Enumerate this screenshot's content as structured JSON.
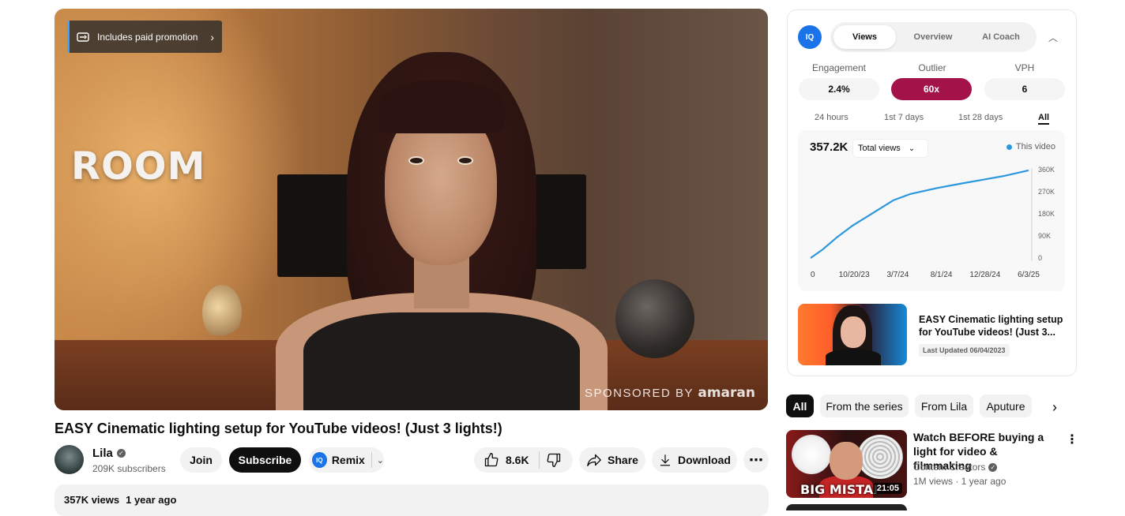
{
  "player": {
    "paid_promotion": "Includes paid promotion",
    "overlay_word": "ROOM",
    "sponsored_prefix": "SPONSORED BY",
    "sponsor_brand": "amaran"
  },
  "video": {
    "title": "EASY Cinematic lighting setup for YouTube videos! (Just 3 lights!)",
    "channel_name": "Lila",
    "subscribers": "209K subscribers",
    "join_label": "Join",
    "subscribe_label": "Subscribe",
    "remix_label": "Remix",
    "likes": "8.6K",
    "share_label": "Share",
    "download_label": "Download",
    "views": "357K views",
    "age": "1 year ago"
  },
  "analytics": {
    "logo_text": "IQ",
    "tabs": [
      "Views",
      "Overview",
      "AI Coach"
    ],
    "active_tab": "Views",
    "metrics": [
      {
        "label": "Engagement",
        "value": "2.4%"
      },
      {
        "label": "Outlier",
        "value": "60x"
      },
      {
        "label": "VPH",
        "value": "6"
      }
    ],
    "ranges": [
      "24 hours",
      "1st 7 days",
      "1st 28 days",
      "All"
    ],
    "active_range": "All",
    "total": "357.2K",
    "select_value": "Total views",
    "legend": "This video",
    "accent_color": "#2d97de",
    "outlier_color": "#a3134a"
  },
  "chart_data": {
    "type": "line",
    "x": [
      "2023-06-04",
      "2023-07-15",
      "2023-09-01",
      "2023-10-20",
      "2024-01-01",
      "2024-03-07",
      "2024-05-01",
      "2024-08-01",
      "2024-10-15",
      "2024-12-28",
      "2025-03-15",
      "2025-06-03"
    ],
    "series": [
      {
        "values": [
          0,
          35000,
          85000,
          130000,
          185000,
          235000,
          260000,
          285000,
          302000,
          318000,
          335000,
          357200
        ]
      }
    ],
    "x_tick_labels": [
      "0",
      "10/20/23",
      "3/7/24",
      "8/1/24",
      "12/28/24",
      "6/3/25"
    ],
    "y_tick_labels": [
      "0",
      "90K",
      "180K",
      "270K",
      "360K"
    ],
    "ylim": [
      0,
      360000
    ]
  },
  "analytics_video": {
    "title": "EASY Cinematic lighting setup for YouTube videos! (Just 3...",
    "updated": "Last Updated 06/04/2023"
  },
  "chips": [
    "All",
    "From the series",
    "From Lila",
    "Aputure"
  ],
  "recommendation": {
    "title": "Watch BEFORE buying a light for video & filmmaking",
    "channel": "Content Creators",
    "meta": "1M views · 1 year ago",
    "duration": "21:05",
    "thumb_text": "BIG MISTAI"
  }
}
